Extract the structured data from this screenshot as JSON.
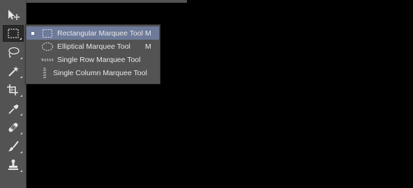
{
  "toolbar": {
    "tools": [
      {
        "icon": "move-icon"
      },
      {
        "icon": "rectangular-marquee-icon",
        "active": true
      },
      {
        "icon": "lasso-icon"
      },
      {
        "icon": "magic-wand-icon"
      },
      {
        "icon": "crop-icon"
      },
      {
        "icon": "eyedropper-icon"
      },
      {
        "icon": "healing-brush-icon"
      },
      {
        "icon": "brush-icon"
      },
      {
        "icon": "clone-stamp-icon"
      }
    ]
  },
  "flyout": {
    "items": [
      {
        "label": "Rectangular Marquee Tool",
        "shortcut": "M",
        "selected": true,
        "icon": "rectangular-marquee-icon"
      },
      {
        "label": "Elliptical Marquee Tool",
        "shortcut": "M",
        "selected": false,
        "icon": "elliptical-marquee-icon"
      },
      {
        "label": "Single Row Marquee Tool",
        "shortcut": "",
        "selected": false,
        "icon": "single-row-marquee-icon"
      },
      {
        "label": "Single Column Marquee Tool",
        "shortcut": "",
        "selected": false,
        "icon": "single-column-marquee-icon"
      }
    ]
  },
  "colors": {
    "panel": "#535353",
    "highlight": "#6e7a99",
    "canvas": "#000000"
  }
}
